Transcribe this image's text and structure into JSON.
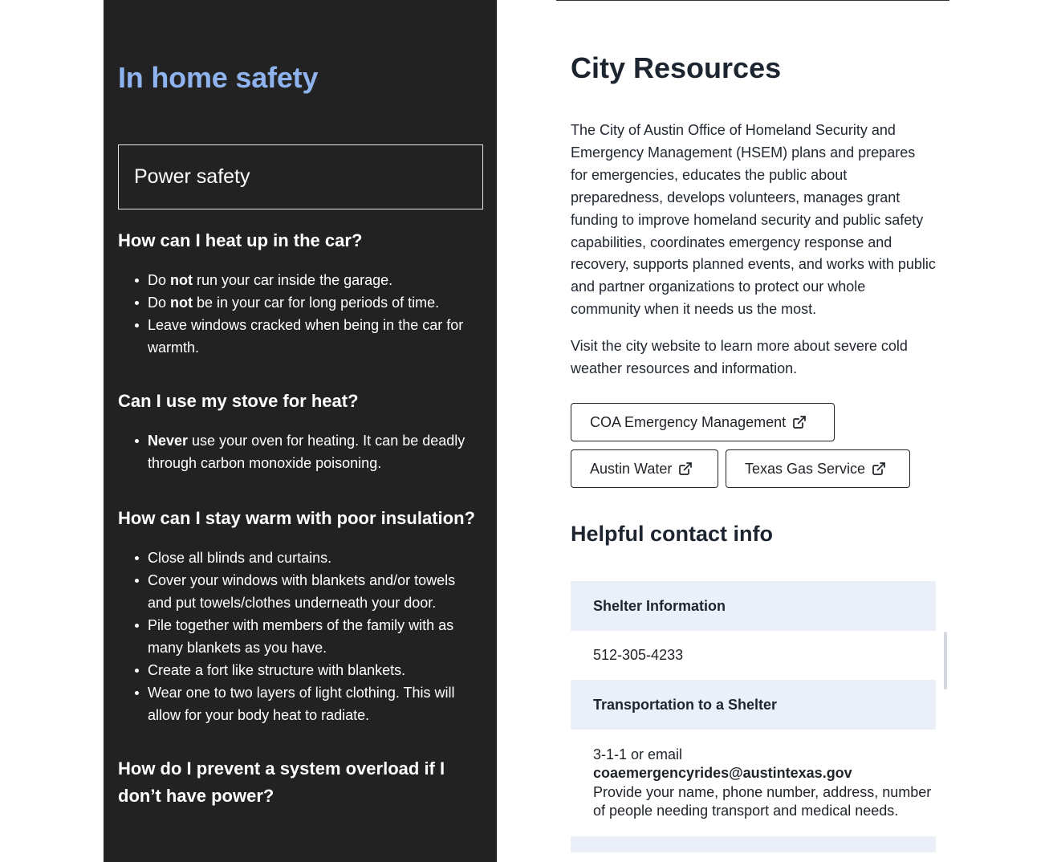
{
  "left": {
    "title": "In home safety",
    "accordion_label": "Power safety",
    "sections": [
      {
        "heading": "How can I heat up in the car?",
        "items": [
          {
            "pre": "Do ",
            "bold": "not",
            "post": " run your car inside the garage."
          },
          {
            "pre": "Do ",
            "bold": "not",
            "post": " be in your car for long periods of time."
          },
          {
            "pre": "Leave windows cracked when being in the car for warmth.",
            "bold": "",
            "post": ""
          }
        ]
      },
      {
        "heading": "Can I use my stove for heat?",
        "items": [
          {
            "pre": "",
            "bold": "Never",
            "post": " use your oven for heating. It can be deadly through carbon monoxide poisoning."
          }
        ]
      },
      {
        "heading": "How can I stay warm with poor insulation?",
        "items": [
          {
            "pre": "Close all blinds and curtains.",
            "bold": "",
            "post": ""
          },
          {
            "pre": "Cover your windows with blankets and/or towels and put towels/clothes underneath your door.",
            "bold": "",
            "post": ""
          },
          {
            "pre": "Pile together with members of the family with as many blankets as you have.",
            "bold": "",
            "post": ""
          },
          {
            "pre": "Create a fort like structure with blankets.",
            "bold": "",
            "post": ""
          },
          {
            "pre": "Wear one to two layers of light clothing. This will allow for your body heat to radiate.",
            "bold": "",
            "post": ""
          }
        ]
      },
      {
        "heading": "How do I prevent a system overload if I don’t have power?",
        "items": []
      }
    ]
  },
  "right": {
    "title": "City Resources",
    "paragraph1": "The City of Austin Office of Homeland Security and Emergency Management (HSEM) plans and prepares for emergencies, educates the public about preparedness, develops volunteers, manages grant funding to improve homeland security and public safety capabilities, coordinates emergency response and recovery, supports planned events, and works with public and partner organizations to protect our whole community when it needs us the most.",
    "paragraph2": "Visit the city website to learn more about severe cold weather resources and information.",
    "buttons": {
      "coa": "COA Emergency Management",
      "water": "Austin Water",
      "gas": "Texas Gas Service"
    },
    "contact_title": "Helpful contact info",
    "contacts": {
      "shelter_label": "Shelter Information",
      "shelter_value": "512-305-4233",
      "transport_label": "Transportation to a Shelter",
      "transport_line1": "3-1-1 or email",
      "transport_email": "coaemergencyrides@austintexas.gov",
      "transport_line2": "Provide your name, phone number, address, number of people needing transport and medical needs."
    }
  },
  "icons": {
    "external": "external-link-icon"
  },
  "colors": {
    "left_bg": "#222222",
    "left_title": "#8fb3ee",
    "contact_header_bg": "#ebeff7"
  }
}
